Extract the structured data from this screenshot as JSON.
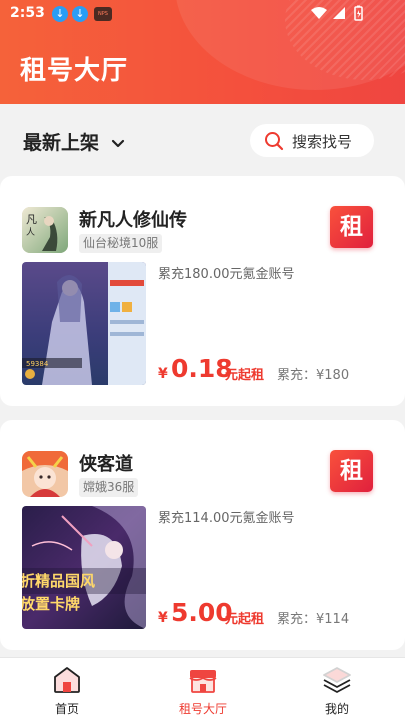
{
  "status_bar": {
    "time": "2:53",
    "app_badge": "NPS"
  },
  "header": {
    "title": "租号大厅"
  },
  "filter": {
    "sort_label": "最新上架",
    "search_label": "搜索找号"
  },
  "listings": [
    {
      "game": "新凡人修仙传",
      "server": "仙台秘境10服",
      "badge": "租",
      "description": "累充180.00元氪金账号",
      "currency": "¥",
      "price": "0.18",
      "price_unit": "元起租",
      "total": "累充：¥180"
    },
    {
      "game": "侠客道",
      "server": "嫦娥36服",
      "badge": "租",
      "description": "累充114.00元氪金账号",
      "currency": "¥",
      "price": "5.00",
      "price_unit": "元起租",
      "total": "累充：¥114"
    }
  ],
  "bottom_nav": {
    "home": "首页",
    "hall": "租号大厅",
    "mine": "我的",
    "active": "hall",
    "active_color": "#ee3a2f"
  }
}
